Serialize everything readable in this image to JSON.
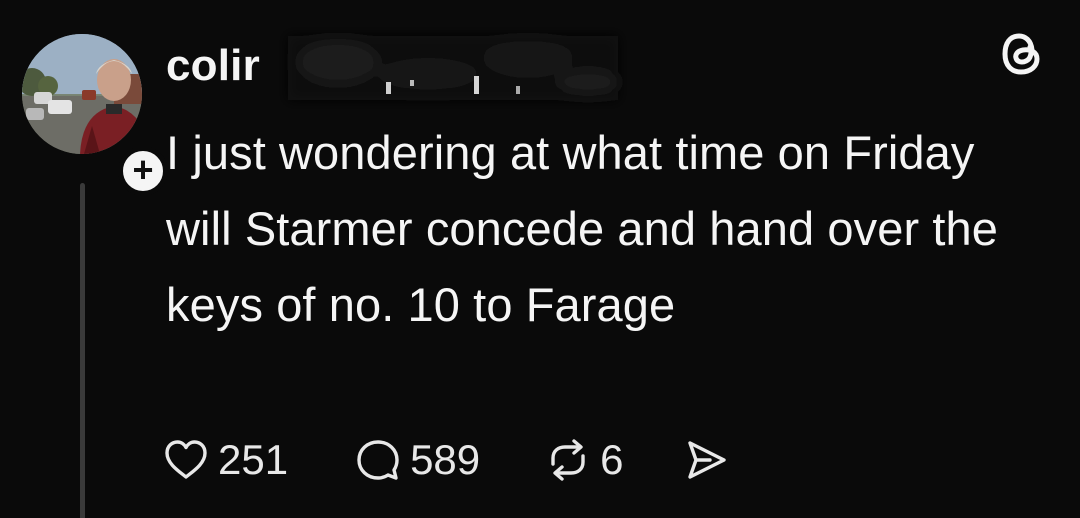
{
  "post": {
    "username": "colir",
    "text": "I just wondering at what time on Friday will Starmer concede and hand over the keys of no. 10 to Farage",
    "follow_badge": "+",
    "stats": {
      "likes": "251",
      "replies": "589",
      "reposts": "6"
    }
  },
  "icons": {
    "app_logo": "threads-logo-icon",
    "like": "heart-icon",
    "reply": "speech-bubble-icon",
    "repost": "repost-arrows-icon",
    "share": "send-arrow-icon"
  },
  "colors": {
    "background": "#0a0a0a",
    "text": "#f5f5f5",
    "thread_line": "#3a3a3a"
  }
}
